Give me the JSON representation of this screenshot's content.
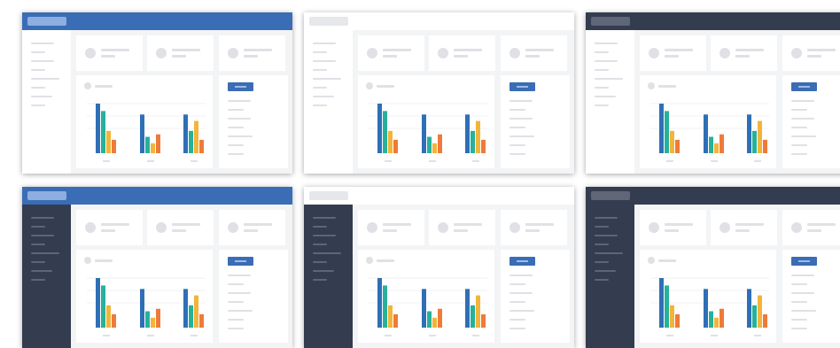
{
  "gallery": {
    "variants": [
      {
        "id": "blue-light",
        "header": "blue",
        "sidebar": "light"
      },
      {
        "id": "white-light",
        "header": "white",
        "sidebar": "light"
      },
      {
        "id": "dark-light",
        "header": "dark",
        "sidebar": "light"
      },
      {
        "id": "blue-dark",
        "header": "blue",
        "sidebar": "dark"
      },
      {
        "id": "white-dark",
        "header": "white",
        "sidebar": "dark"
      },
      {
        "id": "dark-dark",
        "header": "dark",
        "sidebar": "dark"
      }
    ]
  },
  "colors": {
    "header_blue": "#3a6db5",
    "header_white": "#ffffff",
    "header_dark": "#343c4f",
    "sidebar_light": "#ffffff",
    "sidebar_dark": "#343c4f",
    "content_bg": "#f3f4f6",
    "placeholder": "#dfe1e5",
    "button": "#3a6db5",
    "series": [
      "#2f6fb6",
      "#26b19b",
      "#f2b43a",
      "#ee7b3a"
    ]
  },
  "chart_data": {
    "type": "bar",
    "categories": [
      "",
      "",
      ""
    ],
    "series": [
      {
        "values": [
          100,
          78,
          78
        ]
      },
      {
        "values": [
          85,
          33,
          45
        ]
      },
      {
        "values": [
          45,
          20,
          65
        ]
      },
      {
        "values": [
          27,
          38,
          27
        ]
      }
    ],
    "ylim": [
      0,
      100
    ],
    "grid": true,
    "title": "",
    "xlabel": "",
    "ylabel": ""
  }
}
